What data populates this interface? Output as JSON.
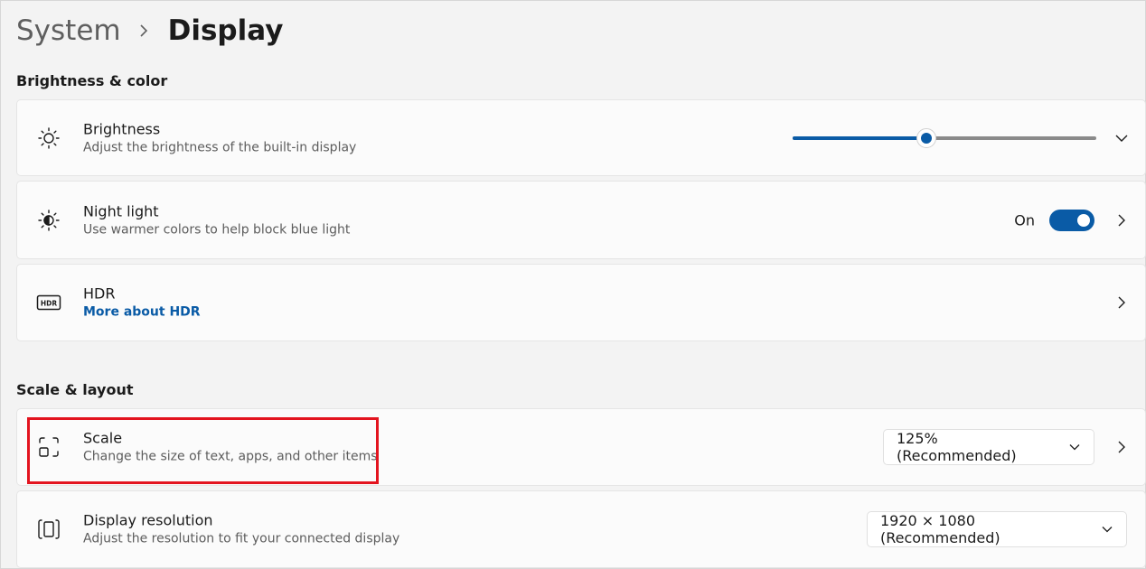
{
  "breadcrumb": {
    "parent": "System",
    "current": "Display"
  },
  "sections": {
    "brightness_color": "Brightness & color",
    "scale_layout": "Scale & layout"
  },
  "brightness": {
    "title": "Brightness",
    "subtitle": "Adjust the brightness of the built-in display",
    "level": 0.44,
    "icon": "sun-icon"
  },
  "night_light": {
    "title": "Night light",
    "subtitle": "Use warmer colors to help block blue light",
    "state_label": "On",
    "enabled": true,
    "icon": "night-light-icon"
  },
  "hdr": {
    "title": "HDR",
    "link": "More about HDR",
    "icon": "hdr-icon"
  },
  "scale": {
    "title": "Scale",
    "subtitle": "Change the size of text, apps, and other items",
    "value": "125% (Recommended)",
    "icon": "scale-icon"
  },
  "resolution": {
    "title": "Display resolution",
    "subtitle": "Adjust the resolution to fit your connected display",
    "value": "1920 × 1080 (Recommended)",
    "icon": "resolution-icon"
  },
  "colors": {
    "accent": "#0a5ba6",
    "highlight": "#e3141f"
  }
}
